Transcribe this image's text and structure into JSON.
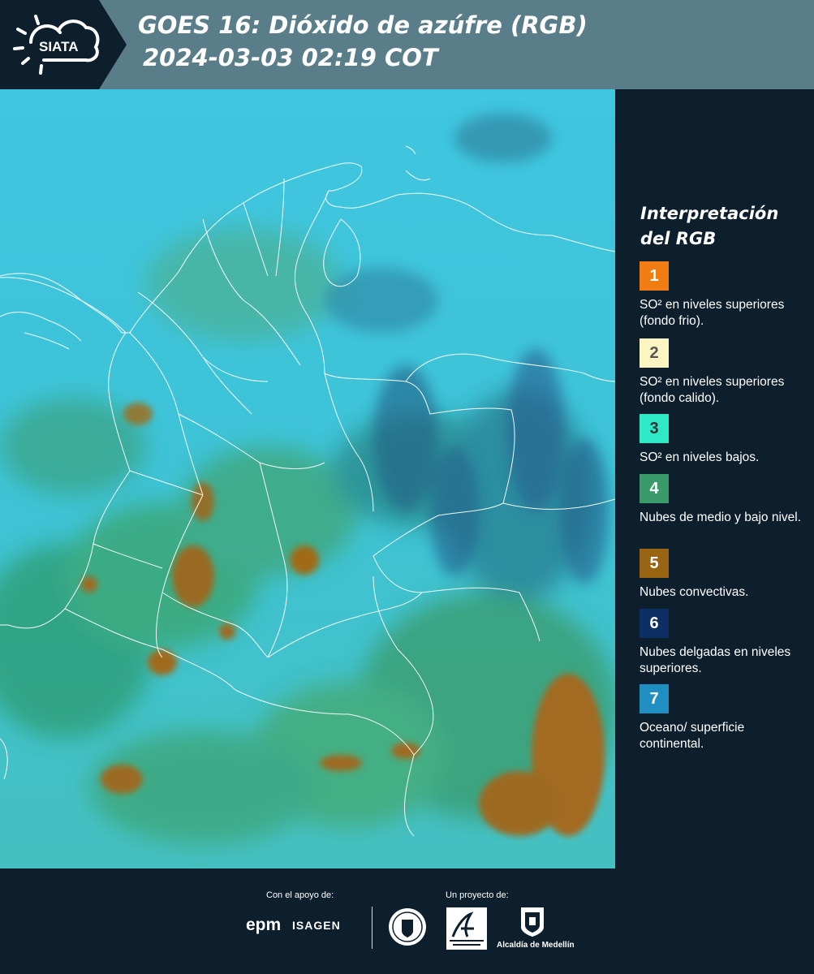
{
  "header": {
    "logo_text": "SIATA",
    "title": "GOES 16: Dióxido de azúfre (RGB)",
    "datetime": "2024-03-03 02:19 COT"
  },
  "legend": {
    "title": "Interpretación del RGB",
    "items": [
      {
        "number": "1",
        "color": "#f07d14",
        "text_color": "#ffffff",
        "label": "SO² en niveles superiores (fondo frio)."
      },
      {
        "number": "2",
        "color": "#fcf5c2",
        "text_color": "#555555",
        "label": "SO² en niveles superiores (fondo calido)."
      },
      {
        "number": "3",
        "color": "#2ee8c6",
        "text_color": "#333333",
        "label": "SO² en niveles bajos."
      },
      {
        "number": "4",
        "color": "#3a9a6a",
        "text_color": "#ffffff",
        "label": "Nubes de medio y bajo nivel."
      },
      {
        "number": "5",
        "color": "#9a6512",
        "text_color": "#ffffff",
        "label": "Nubes convectivas."
      },
      {
        "number": "6",
        "color": "#0e2f63",
        "text_color": "#ffffff",
        "label": "Nubes delgadas en niveles superiores."
      },
      {
        "number": "7",
        "color": "#1f8fc2",
        "text_color": "#ffffff",
        "label": "Oceano/ superficie continental."
      }
    ]
  },
  "footer": {
    "support_label": "Con el apoyo de:",
    "project_label": "Un proyecto de:",
    "sponsor_1": "epm",
    "sponsor_2": "ISAGEN",
    "partner_3": "Alcaldía de Medellín"
  },
  "colors": {
    "background": "#0d1f2d",
    "header": "#5a7d8a",
    "ocean": "#3ec4dc",
    "border_lines": "#ffffff"
  }
}
